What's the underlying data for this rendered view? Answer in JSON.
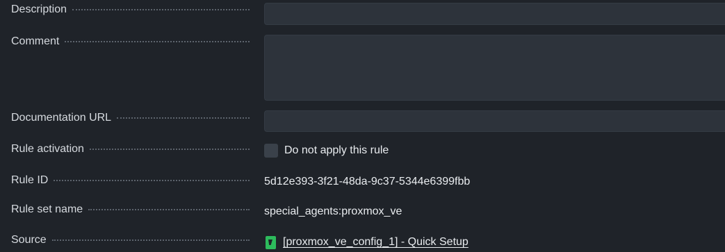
{
  "rules_form": {
    "description": {
      "label": "Description",
      "value": ""
    },
    "comment": {
      "label": "Comment",
      "value": ""
    },
    "documentation_url": {
      "label": "Documentation URL",
      "value": ""
    },
    "rule_activation": {
      "label": "Rule activation",
      "checkbox_label": "Do not apply this rule",
      "checked": false
    },
    "rule_id": {
      "label": "Rule ID",
      "value": "5d12e393-3f21-48da-9c37-5344e6399fbb"
    },
    "rule_set_name": {
      "label": "Rule set name",
      "value": "special_agents:proxmox_ve"
    },
    "source": {
      "label": "Source",
      "icon": "quick-setup-icon",
      "link_text": "[proxmox_ve_config_1] - Quick Setup"
    }
  },
  "colors": {
    "background": "#1f2329",
    "field_background": "#2d333b",
    "icon_green": "#2dbb5c",
    "text": "#e9ecef"
  }
}
